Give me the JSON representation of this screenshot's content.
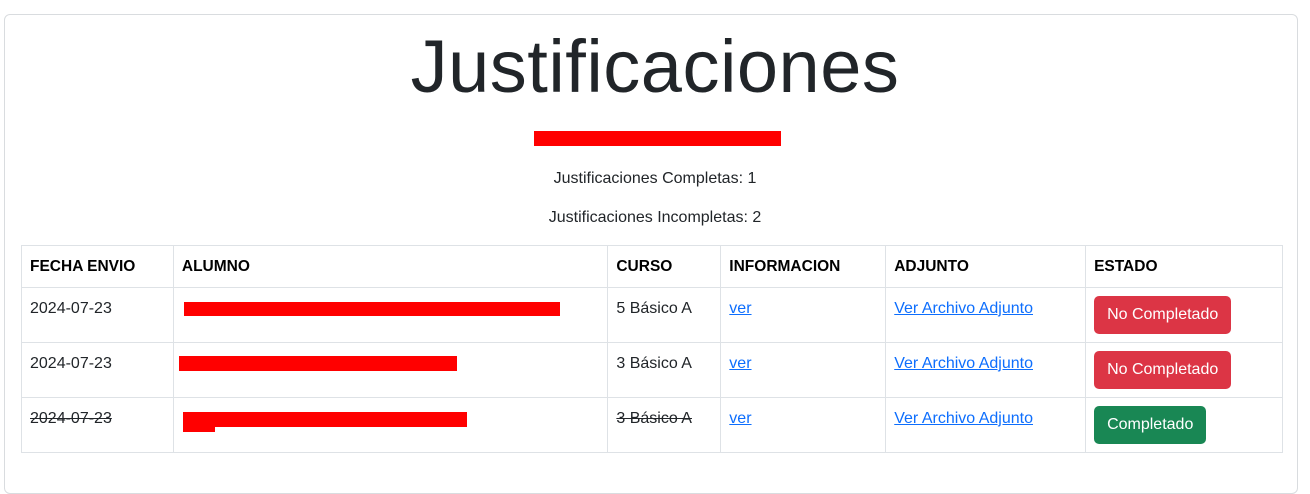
{
  "page": {
    "title": "Justificaciones",
    "completed_label": "Justificaciones Completas: 1",
    "incomplete_label": "Justificaciones Incompletas: 2"
  },
  "table": {
    "headers": [
      "FECHA ENVIO",
      "ALUMNO",
      "CURSO",
      "INFORMACION",
      "ADJUNTO",
      "ESTADO"
    ],
    "rows": [
      {
        "fecha": "2024-07-23",
        "curso": "5 Básico A",
        "info_link": "ver",
        "adjunto_link": "Ver Archivo Adjunto",
        "estado": "No Completado",
        "estado_color": "#dc3545",
        "struck": false
      },
      {
        "fecha": "2024-07-23",
        "curso": "3 Básico A",
        "info_link": "ver",
        "adjunto_link": "Ver Archivo Adjunto",
        "estado": "No Completado",
        "estado_color": "#dc3545",
        "struck": false
      },
      {
        "fecha": "2024-07-23",
        "curso": "3 Básico A",
        "info_link": "ver",
        "adjunto_link": "Ver Archivo Adjunto",
        "estado": "Completado",
        "estado_color": "#198754",
        "struck": true
      }
    ]
  },
  "colors": {
    "redaction": "#ff0000",
    "link": "#0d6efd",
    "danger": "#dc3545",
    "success": "#198754"
  }
}
